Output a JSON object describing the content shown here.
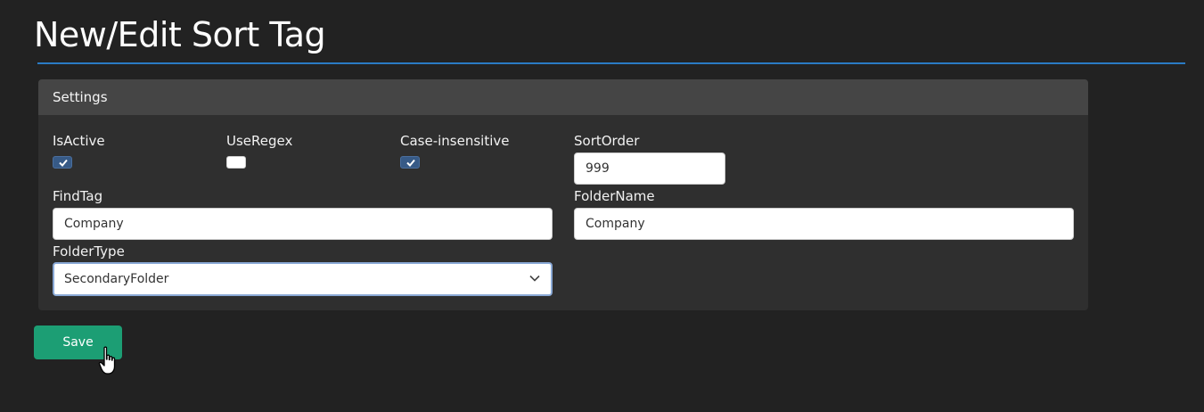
{
  "page": {
    "title": "New/Edit Sort Tag"
  },
  "settings": {
    "header": "Settings",
    "is_active": {
      "label": "IsActive",
      "checked": true
    },
    "use_regex": {
      "label": "UseRegex",
      "checked": false
    },
    "case_insensitive": {
      "label": "Case-insensitive",
      "checked": true
    },
    "sort_order": {
      "label": "SortOrder",
      "value": "999"
    },
    "find_tag": {
      "label": "FindTag",
      "value": "Company"
    },
    "folder_name": {
      "label": "FolderName",
      "value": "Company"
    },
    "folder_type": {
      "label": "FolderType",
      "selected": "SecondaryFolder"
    }
  },
  "actions": {
    "save_label": "Save"
  },
  "colors": {
    "background": "#222222",
    "accent_rule": "#2a7bc4",
    "save_button": "#1c9e74",
    "checkbox_checked": "#375a86"
  }
}
